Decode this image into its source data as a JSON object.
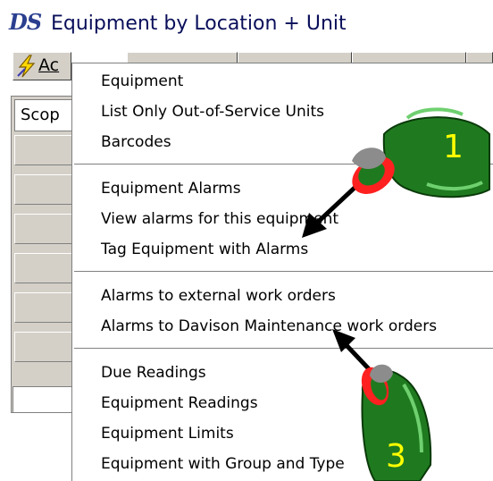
{
  "window": {
    "logo": "DS",
    "title": "Equipment by Location + Unit"
  },
  "toolbar": {
    "action_label": "Ac"
  },
  "grid": {
    "scope_label": "Scop"
  },
  "menu": {
    "groups": [
      [
        "Equipment",
        "List Only Out-of-Service Units",
        "Barcodes"
      ],
      [
        "Equipment Alarms",
        "View alarms for this equipment",
        "Tag Equipment with Alarms"
      ],
      [
        "Alarms to external work orders",
        "Alarms to Davison Maintenance work orders"
      ],
      [
        "Due Readings",
        "Equipment Readings",
        "Equipment Limits",
        "Equipment with Group and Type"
      ]
    ]
  },
  "callouts": {
    "step_1": "1",
    "step_3": "3"
  },
  "colors": {
    "title_text": "#0a0f5a",
    "hand": "#1f7a1f",
    "marker": "#ff0000",
    "badge_text": "#ffff00"
  },
  "icons": {
    "action": "lightning-icon",
    "pointer": "pointing-hand-icon",
    "arrow": "arrow-icon"
  }
}
